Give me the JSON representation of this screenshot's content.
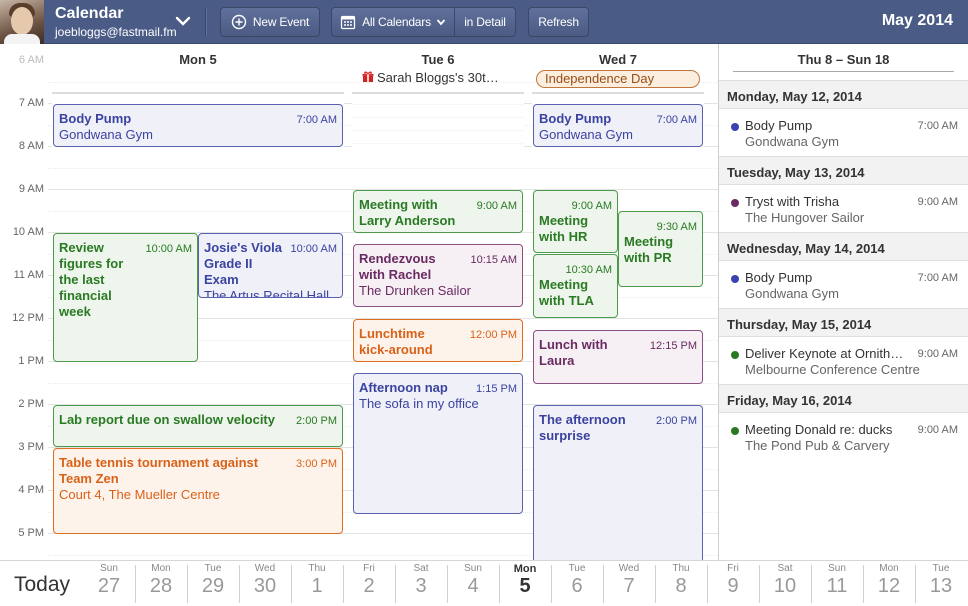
{
  "header": {
    "app_title": "Calendar",
    "user_email": "joebloggs@fastmail.fm",
    "new_event_label": "New Event",
    "all_calendars_label": "All Calendars",
    "in_detail_label": "in Detail",
    "refresh_label": "Refresh",
    "month_title": "May 2014"
  },
  "hours": [
    "6 AM",
    "7 AM",
    "8 AM",
    "9 AM",
    "10 AM",
    "11 AM",
    "12 PM",
    "1 PM",
    "2 PM",
    "3 PM",
    "4 PM",
    "5 PM"
  ],
  "days": {
    "mon": {
      "label": "Mon 5"
    },
    "tue": {
      "label": "Tue 6",
      "allday": "Sarah Bloggs's 30t…"
    },
    "wed": {
      "label": "Wed 7",
      "allday": "Independence Day"
    }
  },
  "events": {
    "mon_pump": {
      "title": "Body Pump",
      "time": "7:00 AM",
      "location": "Gondwana Gym"
    },
    "mon_review": {
      "title": "Review figures for the last financial week",
      "time": "10:00 AM"
    },
    "mon_viola": {
      "title": "Josie's Viola Grade II Exam",
      "time": "10:00 AM",
      "location": "The Artus Recital Hall"
    },
    "mon_lab": {
      "title": "Lab report due on swallow velocity",
      "time": "2:00 PM"
    },
    "mon_tennis": {
      "title": "Table tennis tournament against Team Zen",
      "time": "3:00 PM",
      "location": "Court 4, The Mueller Centre"
    },
    "tue_meeting": {
      "title": "Meeting with Larry Anderson",
      "time": "9:00 AM"
    },
    "tue_rendez": {
      "title": "Rendezvous with Rachel",
      "time": "10:15 AM",
      "location": "The Drunken Sailor"
    },
    "tue_lunch": {
      "title": "Lunchtime kick-around",
      "time": "12:00 PM"
    },
    "tue_nap": {
      "title": "Afternoon nap",
      "time": "1:15 PM",
      "location": "The sofa in my office"
    },
    "wed_pump": {
      "title": "Body Pump",
      "time": "7:00 AM",
      "location": "Gondwana Gym"
    },
    "wed_hr": {
      "title": "Meeting with HR",
      "time": "9:00 AM"
    },
    "wed_pr": {
      "title": "Meeting with PR",
      "time": "9:30 AM"
    },
    "wed_tla": {
      "title": "Meeting with TLA",
      "time": "10:30 AM"
    },
    "wed_laura": {
      "title": "Lunch with Laura",
      "time": "12:15 PM"
    },
    "wed_surprise": {
      "title": "The afternoon surprise",
      "time": "2:00 PM"
    }
  },
  "agenda": {
    "heading": "Thu 8 – Sun 18",
    "groups": [
      {
        "date": "Monday, May 12, 2014",
        "title": "Body Pump",
        "location": "Gondwana Gym",
        "time": "7:00 AM",
        "color": "#3b43b0"
      },
      {
        "date": "Tuesday, May 13, 2014",
        "title": "Tryst with Trisha",
        "location": "The Hungover Sailor",
        "time": "9:00 AM",
        "color": "#6a2a62"
      },
      {
        "date": "Wednesday, May 14, 2014",
        "title": "Body Pump",
        "location": "Gondwana Gym",
        "time": "7:00 AM",
        "color": "#3b43b0"
      },
      {
        "date": "Thursday, May 15, 2014",
        "title": "Deliver Keynote at Ornith…",
        "location": "Melbourne Conference Centre",
        "time": "9:00 AM",
        "color": "#2a7a24"
      },
      {
        "date": "Friday, May 16, 2014",
        "title": "Meeting Donald re: ducks",
        "location": "The Pond Pub & Carvery",
        "time": "9:00 AM",
        "color": "#2a7a24"
      }
    ]
  },
  "footer": {
    "today_label": "Today",
    "days": [
      {
        "name": "Sun",
        "num": "27"
      },
      {
        "name": "Mon",
        "num": "28"
      },
      {
        "name": "Tue",
        "num": "29"
      },
      {
        "name": "Wed",
        "num": "30"
      },
      {
        "name": "Thu",
        "num": "1"
      },
      {
        "name": "Fri",
        "num": "2"
      },
      {
        "name": "Sat",
        "num": "3"
      },
      {
        "name": "Sun",
        "num": "4"
      },
      {
        "name": "Mon",
        "num": "5"
      },
      {
        "name": "Tue",
        "num": "6"
      },
      {
        "name": "Wed",
        "num": "7"
      },
      {
        "name": "Thu",
        "num": "8"
      },
      {
        "name": "Fri",
        "num": "9"
      },
      {
        "name": "Sat",
        "num": "10"
      },
      {
        "name": "Sun",
        "num": "11"
      },
      {
        "name": "Mon",
        "num": "12"
      },
      {
        "name": "Tue",
        "num": "13"
      }
    ],
    "current_index": 8
  }
}
